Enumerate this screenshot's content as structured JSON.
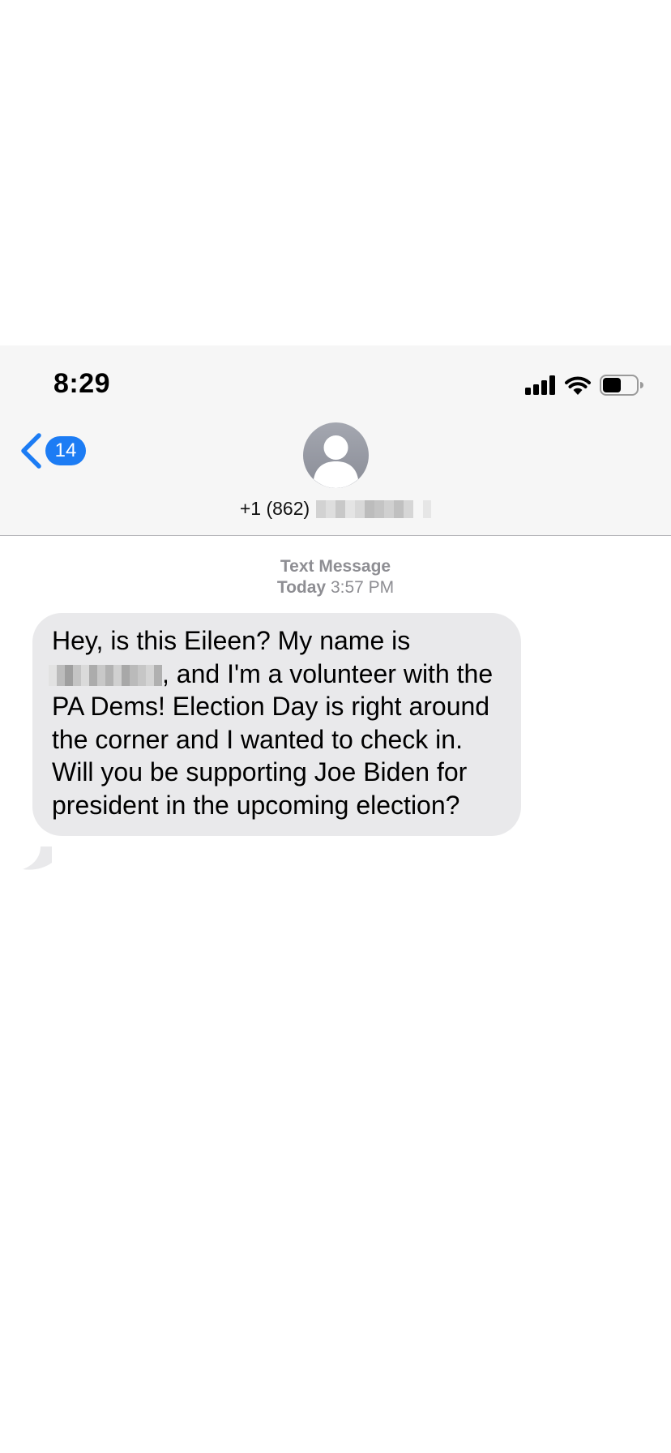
{
  "status_bar": {
    "time": "8:29",
    "icons": [
      "cellular-signal-icon",
      "wifi-icon",
      "battery-icon"
    ]
  },
  "nav": {
    "back_icon": "chevron-left-icon",
    "unread_count": "14"
  },
  "contact": {
    "avatar_icon": "person-silhouette-icon",
    "phone_prefix": "+1 (862)"
  },
  "message_meta": {
    "service": "Text Message",
    "day": "Today",
    "time": "3:57 PM"
  },
  "message": {
    "text_part1": "Hey, is this Eileen? My name is",
    "text_part2": ", and I'm a volunteer with the PA Dems! Election Day is right around the corner and I wanted to check in. Will you be supporting Joe Biden for president in the upcoming election?"
  },
  "colors": {
    "accent": "#1c7cf4",
    "bubble": "#e9e9eb",
    "header_bg": "#f6f6f6",
    "meta_text": "#8e8e93"
  }
}
